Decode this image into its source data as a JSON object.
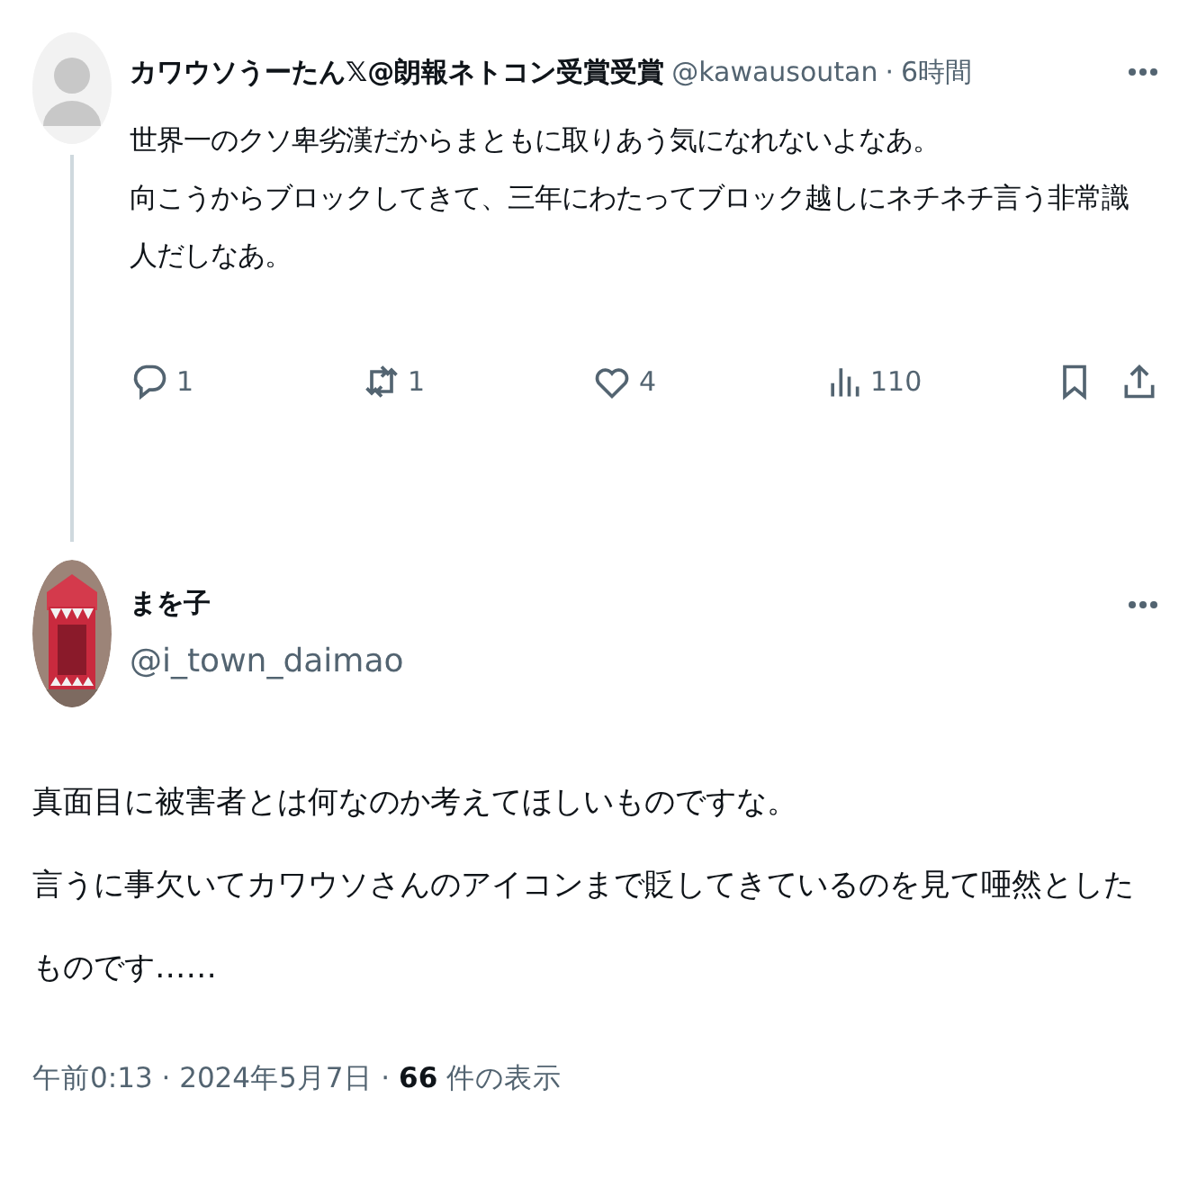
{
  "reply_to": {
    "author": {
      "name": "カワウソうーたん𝕏@朗報ネトコン受賞受賞",
      "handle": "@kawausoutan",
      "separator": "·",
      "time": "6時間"
    },
    "lines": [
      "世界一のクソ卑劣漢だからまともに取りあう気になれないよなあ。",
      "向こうからブロックしてきて、三年にわたってブロック越しにネチネチ言う非常識",
      "人だしなあ。"
    ],
    "actions": [
      {
        "kind": "reply",
        "count": "1"
      },
      {
        "kind": "repost",
        "count": "1"
      },
      {
        "kind": "like",
        "count": "4"
      },
      {
        "kind": "views",
        "count": "110"
      }
    ],
    "tools": [
      {
        "kind": "bookmark"
      },
      {
        "kind": "share"
      }
    ]
  },
  "tweet": {
    "author": {
      "name": "まを子",
      "handle": "@i_town_daimao"
    },
    "lines": [
      "真面目に被害者とは何なのか考えてほしいものですな。",
      "言うに事欠いてカワウソさんのアイコンまで貶してきているのを見て唖然とした",
      "ものです……"
    ],
    "meta": "午前0:13 · 2024年5月7日 · **66** 件の表示"
  }
}
